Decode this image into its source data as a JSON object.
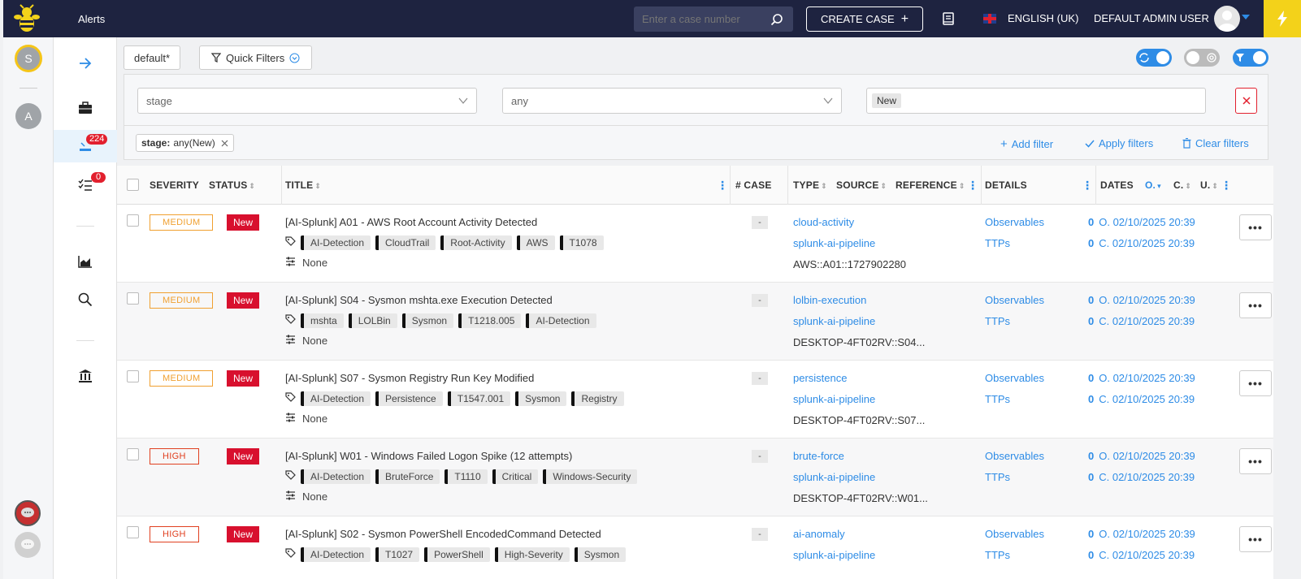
{
  "topbar": {
    "title": "Alerts",
    "search_placeholder": "Enter a case number",
    "create_case_label": "CREATE CASE",
    "language_label": "ENGLISH (UK)",
    "user_label": "DEFAULT ADMIN USER"
  },
  "org_rail": {
    "orgs": [
      {
        "initial": "S",
        "active": true
      },
      {
        "initial": "A",
        "active": false
      }
    ]
  },
  "nav": {
    "alerts_badge": "224",
    "tasks_badge": "0"
  },
  "toolbar": {
    "view_label": "default*",
    "quick_filters_label": "Quick Filters"
  },
  "filter": {
    "field_value": "stage",
    "operator_value": "any",
    "value_chip": "New",
    "active_chip_key": "stage:",
    "active_chip_value": "any(New)",
    "add_filter_label": "Add filter",
    "apply_filters_label": "Apply filters",
    "clear_filters_label": "Clear filters"
  },
  "table": {
    "headers": {
      "severity": "SEVERITY",
      "status": "STATUS",
      "title": "TITLE",
      "case": "# CASE",
      "type": "TYPE",
      "source": "SOURCE",
      "reference": "REFERENCE",
      "details": "DETAILS",
      "dates": "DATES",
      "dates_o": "O.",
      "dates_c": "C.",
      "dates_u": "U."
    },
    "rows": [
      {
        "severity": "MEDIUM",
        "severity_level": "medium",
        "status": "New",
        "title": "[AI-Splunk] A01 - AWS Root Account Activity Detected",
        "tags": [
          "AI-Detection",
          "CloudTrail",
          "Root-Activity",
          "AWS",
          "T1078"
        ],
        "custom_fields": "None",
        "case": "-",
        "type": "cloud-activity",
        "source": "splunk-ai-pipeline",
        "reference": "AWS::A01::1727902280",
        "observables_label": "Observables",
        "ttps_label": "TTPs",
        "observables_count": "0",
        "ttps_count": "0",
        "date_o": "O. 02/10/2025 20:39",
        "date_c": "C. 02/10/2025 20:39"
      },
      {
        "severity": "MEDIUM",
        "severity_level": "medium",
        "status": "New",
        "title": "[AI-Splunk] S04 - Sysmon mshta.exe Execution Detected",
        "tags": [
          "mshta",
          "LOLBin",
          "Sysmon",
          "T1218.005",
          "AI-Detection"
        ],
        "custom_fields": "None",
        "case": "-",
        "type": "lolbin-execution",
        "source": "splunk-ai-pipeline",
        "reference": "DESKTOP-4FT02RV::S04...",
        "observables_label": "Observables",
        "ttps_label": "TTPs",
        "observables_count": "0",
        "ttps_count": "0",
        "date_o": "O. 02/10/2025 20:39",
        "date_c": "C. 02/10/2025 20:39"
      },
      {
        "severity": "MEDIUM",
        "severity_level": "medium",
        "status": "New",
        "title": "[AI-Splunk] S07 - Sysmon Registry Run Key Modified",
        "tags": [
          "AI-Detection",
          "Persistence",
          "T1547.001",
          "Sysmon",
          "Registry"
        ],
        "custom_fields": "None",
        "case": "-",
        "type": "persistence",
        "source": "splunk-ai-pipeline",
        "reference": "DESKTOP-4FT02RV::S07...",
        "observables_label": "Observables",
        "ttps_label": "TTPs",
        "observables_count": "0",
        "ttps_count": "0",
        "date_o": "O. 02/10/2025 20:39",
        "date_c": "C. 02/10/2025 20:39"
      },
      {
        "severity": "HIGH",
        "severity_level": "high",
        "status": "New",
        "title": "[AI-Splunk] W01 - Windows Failed Logon Spike (12 attempts)",
        "tags": [
          "AI-Detection",
          "BruteForce",
          "T1110",
          "Critical",
          "Windows-Security"
        ],
        "custom_fields": "None",
        "case": "-",
        "type": "brute-force",
        "source": "splunk-ai-pipeline",
        "reference": "DESKTOP-4FT02RV::W01...",
        "observables_label": "Observables",
        "ttps_label": "TTPs",
        "observables_count": "0",
        "ttps_count": "0",
        "date_o": "O. 02/10/2025 20:39",
        "date_c": "C. 02/10/2025 20:39"
      },
      {
        "severity": "HIGH",
        "severity_level": "high",
        "status": "New",
        "title": "[AI-Splunk] S02 - Sysmon PowerShell EncodedCommand Detected",
        "tags": [
          "AI-Detection",
          "T1027",
          "PowerShell",
          "High-Severity",
          "Sysmon"
        ],
        "custom_fields": "",
        "case": "-",
        "type": "ai-anomaly",
        "source": "splunk-ai-pipeline",
        "reference": "",
        "observables_label": "Observables",
        "ttps_label": "TTPs",
        "observables_count": "0",
        "ttps_count": "0",
        "date_o": "O. 02/10/2025 20:39",
        "date_c": "C. 02/10/2025 20:39"
      }
    ]
  },
  "colors": {
    "topbar_bg": "#1e2340",
    "accent_blue": "#2e8ce6",
    "new_status": "#d8102e",
    "severity_medium": "#f0a030",
    "severity_high": "#e04020",
    "bolt_yellow": "#f3d21a"
  }
}
